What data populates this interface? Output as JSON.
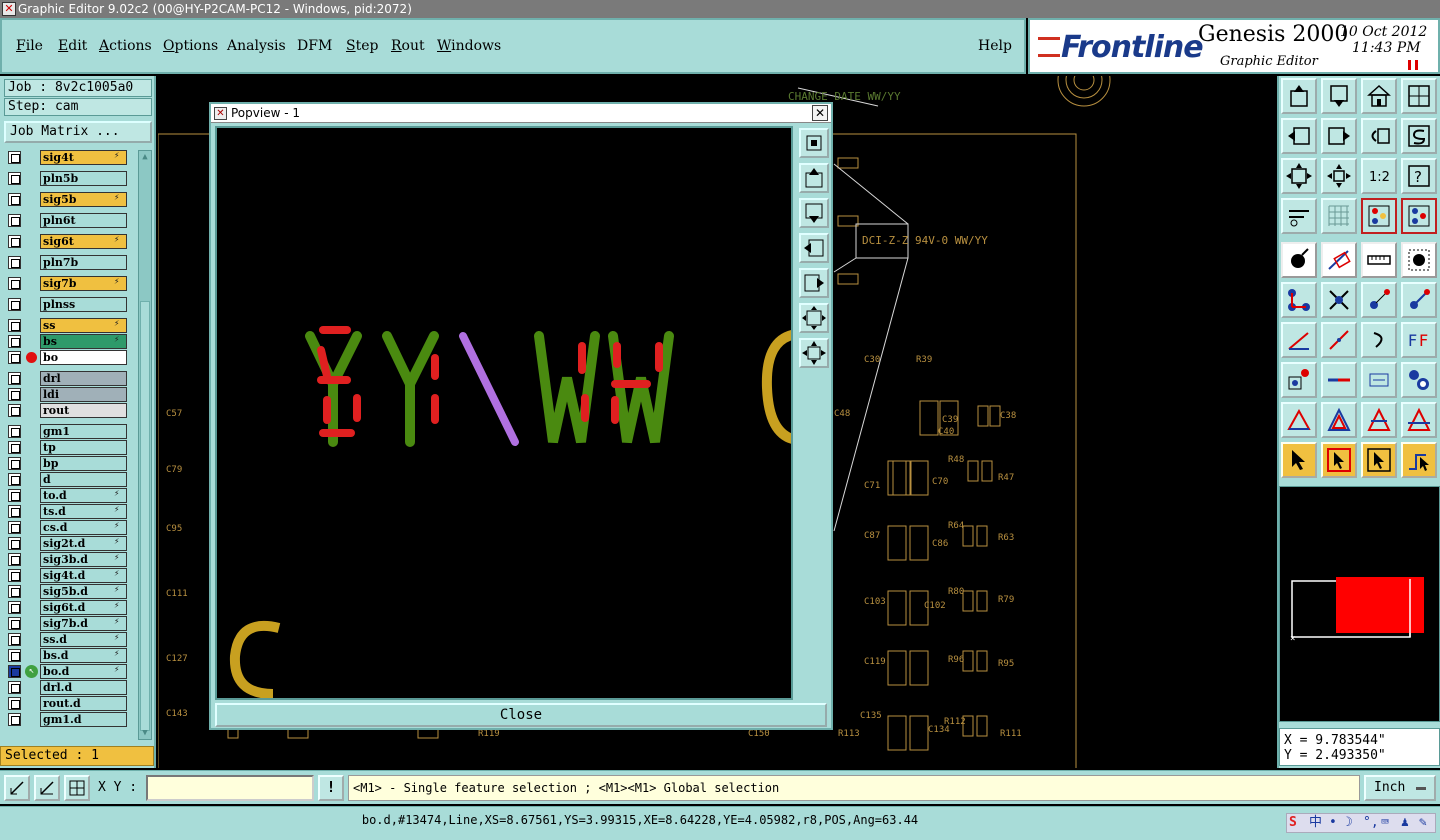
{
  "window": {
    "title": "Graphic Editor 9.02c2 (00@HY-P2CAM-PC12 - Windows, pid:2072)"
  },
  "menu": {
    "items": [
      {
        "first": "F",
        "rest": "ile"
      },
      {
        "first": "E",
        "rest": "dit"
      },
      {
        "first": "A",
        "rest": "ctions"
      },
      {
        "first": "O",
        "rest": "ptions"
      },
      {
        "first": "",
        "rest": "Analysis"
      },
      {
        "first": "",
        "rest": "DFM"
      },
      {
        "first": "S",
        "rest": "tep"
      },
      {
        "first": "R",
        "rest": "out"
      },
      {
        "first": "W",
        "rest": "indows"
      }
    ],
    "help": "Help"
  },
  "brand": {
    "logo": "Frontline",
    "product": "Genesis 2000",
    "subtitle": "Graphic Editor",
    "date": "10 Oct 2012",
    "time": "11:43 PM"
  },
  "left": {
    "job": "Job : 8v2c1005a0",
    "step": "Step: cam",
    "job_matrix": "Job Matrix ...",
    "layers": [
      {
        "name": "sig4t",
        "color": "#f0c040",
        "flag": true
      },
      {
        "name": "pln5b",
        "color": "#a8dcd8",
        "flag": false
      },
      {
        "name": "sig5b",
        "color": "#f0c040",
        "flag": true
      },
      {
        "name": "pln6t",
        "color": "#a8dcd8",
        "flag": false
      },
      {
        "name": "sig6t",
        "color": "#f0c040",
        "flag": true
      },
      {
        "name": "pln7b",
        "color": "#a8dcd8",
        "flag": false
      },
      {
        "name": "sig7b",
        "color": "#f0c040",
        "flag": true
      },
      {
        "name": "plnss",
        "color": "#a8dcd8",
        "flag": false
      },
      {
        "name": "ss",
        "color": "#f0c040",
        "flag": true
      },
      {
        "name": "bs",
        "color": "#2e9a6a",
        "flag": true
      },
      {
        "name": "bo",
        "color": "#ffffff",
        "flag": false,
        "active": true
      },
      {
        "name": "drl",
        "color": "#a0b0b8",
        "flag": false
      },
      {
        "name": "ldi",
        "color": "#a0b0b8",
        "flag": false
      },
      {
        "name": "rout",
        "color": "#e0e0e0",
        "flag": false
      },
      {
        "name": "gm1",
        "color": "#a8dcd8",
        "flag": false
      },
      {
        "name": "tp",
        "color": "#a8dcd8",
        "flag": false
      },
      {
        "name": "bp",
        "color": "#a8dcd8",
        "flag": false
      },
      {
        "name": "d",
        "color": "#a8dcd8",
        "flag": false
      },
      {
        "name": "to.d",
        "color": "#a8dcd8",
        "flag": true
      },
      {
        "name": "ts.d",
        "color": "#a8dcd8",
        "flag": true
      },
      {
        "name": "cs.d",
        "color": "#a8dcd8",
        "flag": true
      },
      {
        "name": "sig2t.d",
        "color": "#a8dcd8",
        "flag": true
      },
      {
        "name": "sig3b.d",
        "color": "#a8dcd8",
        "flag": true
      },
      {
        "name": "sig4t.d",
        "color": "#a8dcd8",
        "flag": true
      },
      {
        "name": "sig5b.d",
        "color": "#a8dcd8",
        "flag": true
      },
      {
        "name": "sig6t.d",
        "color": "#a8dcd8",
        "flag": true
      },
      {
        "name": "sig7b.d",
        "color": "#a8dcd8",
        "flag": true
      },
      {
        "name": "ss.d",
        "color": "#a8dcd8",
        "flag": true
      },
      {
        "name": "bs.d",
        "color": "#a8dcd8",
        "flag": true
      },
      {
        "name": "bo.d",
        "color": "#a8dcd8",
        "flag": true,
        "edit": true
      },
      {
        "name": "drl.d",
        "color": "#a8dcd8",
        "flag": false
      },
      {
        "name": "rout.d",
        "color": "#a8dcd8",
        "flag": false
      },
      {
        "name": "gm1.d",
        "color": "#a8dcd8",
        "flag": false
      }
    ],
    "selected": "Selected : 1"
  },
  "canvas": {
    "labels": [
      "CHANGE DATE WW/YY",
      "DCI-Z-Z 94V-0 WW/YY",
      "C57",
      "C79",
      "C95",
      "C111",
      "C127",
      "C143",
      "C30",
      "R39",
      "C48",
      "C39",
      "C40",
      "C38",
      "R47",
      "R48",
      "C70",
      "C71",
      "R63",
      "R64",
      "C86",
      "C87",
      "R79",
      "R80",
      "C103",
      "C102",
      "R95",
      "R96",
      "C119",
      "R111",
      "R112",
      "C134",
      "C135",
      "C150",
      "R119",
      "R113"
    ]
  },
  "popview": {
    "title": "Popview - 1",
    "close_label": "Close",
    "text_glyphs": "YY\\WW"
  },
  "bottom": {
    "xy_label": "X Y :",
    "xy_value": "",
    "bang": "!",
    "prompt": "<M1> - Single feature selection ; <M1><M1> Global selection",
    "unit": "Inch"
  },
  "status": {
    "feature": "bo.d,#13474,Line,XS=8.67561,YS=3.99315,XE=8.64228,YE=4.05982,r8,POS,Ang=63.44"
  },
  "coords": {
    "x": "X = 9.783544\"",
    "y": "Y = 2.493350\""
  },
  "colors": {
    "panel": "#a8dcd8",
    "accent": "#f0c040",
    "canvas": "#000000"
  }
}
